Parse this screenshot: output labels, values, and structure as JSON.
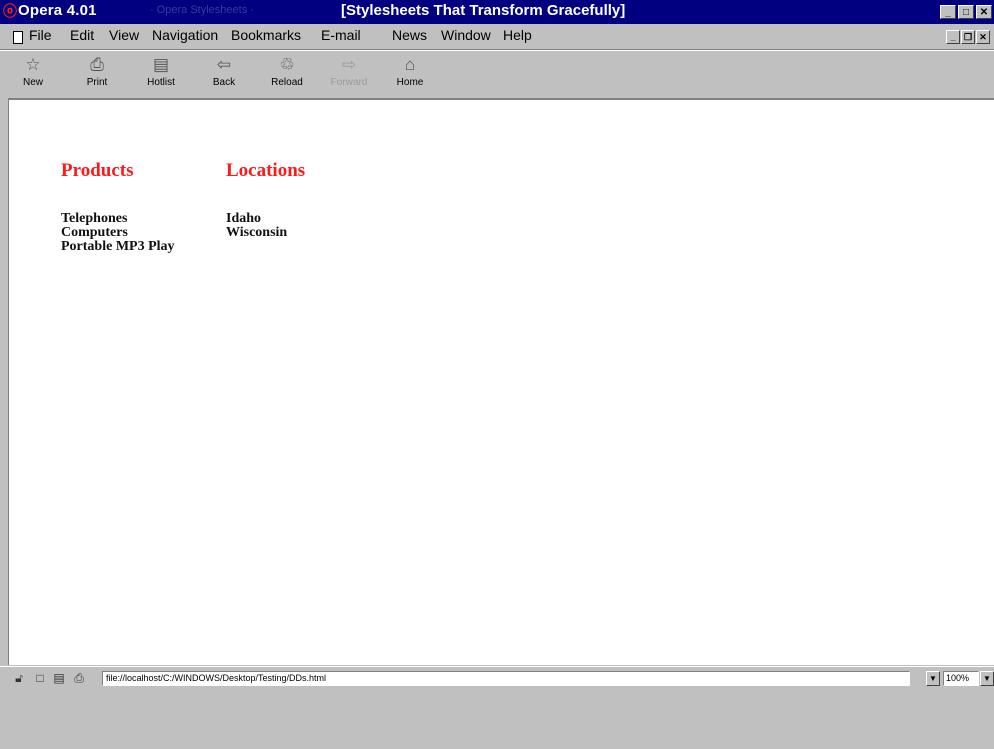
{
  "window": {
    "app_title": "Opera 4.01",
    "document_title": "[Stylesheets That Transform Gracefully]",
    "title_ghost_text": "· Opera Stylesheets ·",
    "minimize": "_",
    "maximize": "□",
    "close": "✕"
  },
  "menu": {
    "items": [
      "File",
      "Edit",
      "View",
      "Navigation",
      "Bookmarks",
      "E-mail",
      "News",
      "Window",
      "Help"
    ],
    "doc_minimize": "_",
    "doc_restore": "❐",
    "doc_close": "✕"
  },
  "toolbar": {
    "items": [
      {
        "label": "New",
        "icon": "new-icon",
        "glyph": "☆"
      },
      {
        "label": "Print",
        "icon": "print-icon",
        "glyph": "⎙"
      },
      {
        "label": "Hotlist",
        "icon": "hotlist-icon",
        "glyph": "▤"
      },
      {
        "label": "Back",
        "icon": "back-arrow-icon",
        "glyph": "⇦"
      },
      {
        "label": "Reload",
        "icon": "reload-icon",
        "glyph": "♲"
      },
      {
        "label": "Forward",
        "icon": "forward-arrow-icon",
        "glyph": "⇨",
        "disabled": true
      },
      {
        "label": "Home",
        "icon": "home-icon",
        "glyph": "⌂"
      }
    ]
  },
  "page": {
    "products": {
      "heading": "Products",
      "items": [
        "Telephones",
        "Computers",
        "Portable MP3 Play"
      ]
    },
    "locations": {
      "heading": "Locations",
      "items": [
        "Idaho",
        "Wisconsin"
      ]
    }
  },
  "statusbar": {
    "address": "file://localhost/C:/WINDOWS/Desktop/Testing/DDs.html",
    "zoom": "100%",
    "icons": [
      "security-icon",
      "window-icon",
      "page-icon",
      "save-icon"
    ]
  },
  "colors": {
    "titlebar": "#000080",
    "heading": "#ff1a1a"
  }
}
